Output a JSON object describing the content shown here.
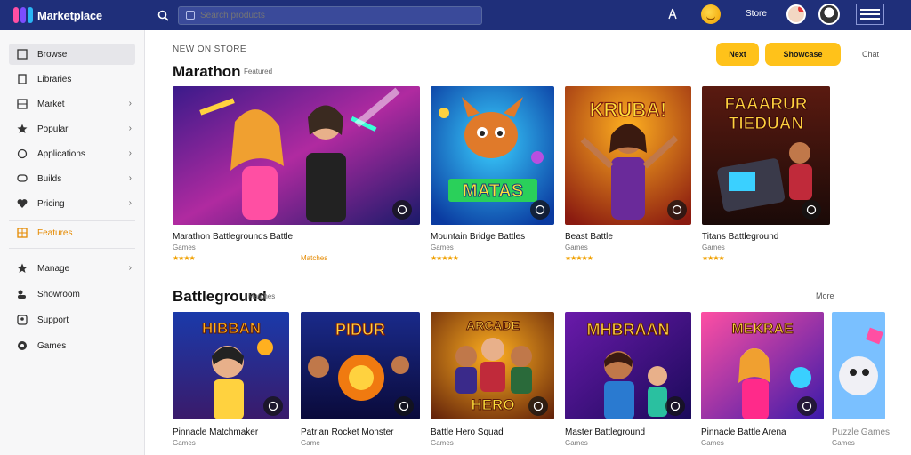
{
  "header": {
    "brand_name": "Marketplace",
    "search_placeholder": "Search products",
    "user_label": "Store",
    "colors": {
      "bar": "#1f2f7a",
      "accent": "#ffc21a"
    }
  },
  "sidebar": {
    "items": [
      {
        "label": "Browse",
        "icon": "square-icon",
        "active": true
      },
      {
        "label": "Libraries",
        "icon": "bookmark-icon"
      },
      {
        "label": "Market",
        "icon": "grid-icon",
        "chevron": true
      },
      {
        "label": "Popular",
        "icon": "star-icon",
        "chevron": true
      },
      {
        "label": "Applications",
        "icon": "chat-icon",
        "chevron": true
      },
      {
        "label": "Builds",
        "icon": "monitor-icon",
        "chevron": true
      },
      {
        "label": "Pricing",
        "icon": "heart-icon",
        "chevron": true
      },
      {
        "label": "Features",
        "icon": "list-icon",
        "highlight": true
      },
      {
        "label": "Manage",
        "icon": "star-icon",
        "chevron": true
      },
      {
        "label": "Showroom",
        "icon": "people-icon"
      },
      {
        "label": "Support",
        "icon": "user-icon"
      },
      {
        "label": "Games",
        "icon": "globe-icon"
      }
    ]
  },
  "main": {
    "overline": "NEW ON STORE",
    "section1": {
      "title": "Marathon",
      "subtitle": "Featured",
      "btn_primary": "Next",
      "btn_secondary": "Showcase",
      "link": "Chat",
      "cards": [
        {
          "title": "Marathon Battlegrounds Battle",
          "sub": "Games",
          "rating": "★★★★",
          "tag": "Matches"
        },
        {
          "title": "Mountain Bridge Battles",
          "sub": "Games",
          "rating": "★★★★★"
        },
        {
          "title": "Beast Battle",
          "sub": "Games",
          "rating": "★★★★★"
        },
        {
          "title": "Titans Battleground",
          "sub": "Games",
          "rating": "★★★★"
        }
      ]
    },
    "section2": {
      "title": "Battleground",
      "subtitle": "Matches",
      "link": "More",
      "cards": [
        {
          "title": "Pinnacle Matchmaker",
          "sub": "Games"
        },
        {
          "title": "Patrian Rocket Monster",
          "sub": "Game"
        },
        {
          "title": "Battle Hero Squad",
          "sub": "Games"
        },
        {
          "title": "Master Battleground",
          "sub": "Games"
        },
        {
          "title": "Pinnacle Battle Arena",
          "sub": "Games"
        },
        {
          "title": "Puzzle Games",
          "sub": "Games"
        }
      ]
    }
  }
}
